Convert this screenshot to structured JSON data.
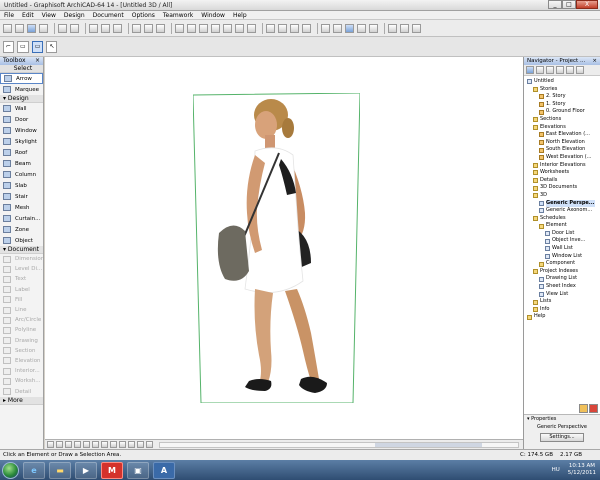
{
  "window": {
    "title": "Untitled - Graphisoft ArchiCAD-64 14 - [Untitled 3D / All]",
    "controls": [
      "_",
      "□",
      "X"
    ]
  },
  "menu": [
    "File",
    "Edit",
    "View",
    "Design",
    "Document",
    "Options",
    "Teamwork",
    "Window",
    "Help"
  ],
  "toolbox": {
    "title": "Toolbox",
    "select_header": "Select",
    "selected_tool": "Arrow",
    "arrow": "Arrow",
    "marquee": "Marquee",
    "design_header": "Design",
    "design_tools": [
      "Wall",
      "Door",
      "Window",
      "Skylight",
      "Roof",
      "Beam",
      "Column",
      "Slab",
      "Stair",
      "Mesh",
      "Curtain...",
      "Zone",
      "Object"
    ],
    "document_header": "Document",
    "document_tools": [
      "Dimension",
      "Level Di...",
      "Text",
      "Label",
      "Fill",
      "Line",
      "Arc/Circle",
      "Polyline",
      "Drawing",
      "Section",
      "Elevation",
      "Interior...",
      "Worksh...",
      "Detail"
    ],
    "more": "More"
  },
  "navigator": {
    "title": "Navigator - Project ...",
    "tree": [
      {
        "label": "Untitled",
        "level": 0,
        "kind": "doc"
      },
      {
        "label": "Stories",
        "level": 1,
        "kind": "folder"
      },
      {
        "label": "2. Story",
        "level": 2,
        "kind": "story"
      },
      {
        "label": "1. Story",
        "level": 2,
        "kind": "story"
      },
      {
        "label": "0. Ground Floor",
        "level": 2,
        "kind": "story"
      },
      {
        "label": "Sections",
        "level": 1,
        "kind": "folder"
      },
      {
        "label": "Elevations",
        "level": 1,
        "kind": "folder"
      },
      {
        "label": "East Elevation (...",
        "level": 2,
        "kind": "story"
      },
      {
        "label": "North Elevation",
        "level": 2,
        "kind": "story"
      },
      {
        "label": "South Elevation",
        "level": 2,
        "kind": "story"
      },
      {
        "label": "West Elevation (...",
        "level": 2,
        "kind": "story"
      },
      {
        "label": "Interior Elevations",
        "level": 1,
        "kind": "folder"
      },
      {
        "label": "Worksheets",
        "level": 1,
        "kind": "folder"
      },
      {
        "label": "Details",
        "level": 1,
        "kind": "folder"
      },
      {
        "label": "3D Documents",
        "level": 1,
        "kind": "folder"
      },
      {
        "label": "3D",
        "level": 1,
        "kind": "folder"
      },
      {
        "label": "Generic Perspe...",
        "level": 2,
        "kind": "doc",
        "bold": true,
        "selected": true
      },
      {
        "label": "Generic Axonom...",
        "level": 2,
        "kind": "doc"
      },
      {
        "label": "Schedules",
        "level": 1,
        "kind": "folder"
      },
      {
        "label": "Element",
        "level": 2,
        "kind": "folder"
      },
      {
        "label": "Door List",
        "level": 3,
        "kind": "doc"
      },
      {
        "label": "Object Inve...",
        "level": 3,
        "kind": "doc"
      },
      {
        "label": "Wall List",
        "level": 3,
        "kind": "doc"
      },
      {
        "label": "Window List",
        "level": 3,
        "kind": "doc"
      },
      {
        "label": "Component",
        "level": 2,
        "kind": "folder"
      },
      {
        "label": "Project Indexes",
        "level": 1,
        "kind": "folder"
      },
      {
        "label": "Drawing List",
        "level": 2,
        "kind": "doc"
      },
      {
        "label": "Sheet Index",
        "level": 2,
        "kind": "doc"
      },
      {
        "label": "View List",
        "level": 2,
        "kind": "doc"
      },
      {
        "label": "Lists",
        "level": 1,
        "kind": "folder"
      },
      {
        "label": "Info",
        "level": 1,
        "kind": "folder"
      },
      {
        "label": "Help",
        "level": 0,
        "kind": "folder"
      }
    ],
    "properties_label": "Properties",
    "properties_value": "Generic Perspective",
    "settings_button": "Settings..."
  },
  "status": {
    "message": "Click an Element or Draw a Selection Area.",
    "disk": "C: 174.5 GB",
    "ram": "2.17 GB"
  },
  "taskbar": {
    "language": "HU",
    "time": "10:13 AM",
    "date": "5/12/2011"
  }
}
